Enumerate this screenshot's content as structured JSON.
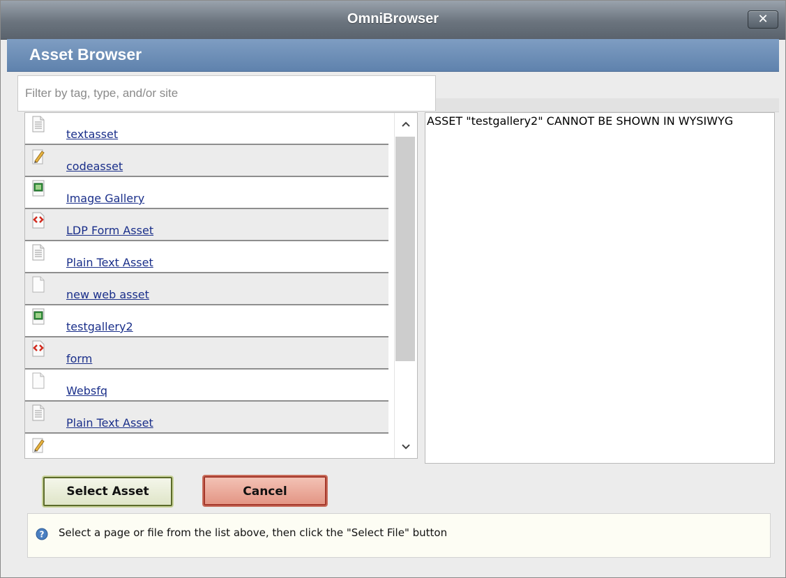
{
  "window": {
    "title": "OmniBrowser",
    "close_label": "✕"
  },
  "header": {
    "title": "Asset Browser"
  },
  "filter": {
    "placeholder": "Filter by tag, type, and/or site",
    "value": ""
  },
  "assets": {
    "items": [
      {
        "label": "textasset",
        "icon": "text-document-icon"
      },
      {
        "label": "codeasset",
        "icon": "pencil-icon"
      },
      {
        "label": "Image Gallery",
        "icon": "image-icon"
      },
      {
        "label": "LDP Form Asset",
        "icon": "form-icon"
      },
      {
        "label": "Plain Text Asset",
        "icon": "text-document-icon"
      },
      {
        "label": "new web asset",
        "icon": "blank-document-icon"
      },
      {
        "label": "testgallery2",
        "icon": "image-icon"
      },
      {
        "label": "form",
        "icon": "form-icon"
      },
      {
        "label": "Websfq",
        "icon": "blank-document-icon"
      },
      {
        "label": "Plain Text Asset",
        "icon": "text-document-icon"
      },
      {
        "label": "",
        "icon": "pencil-icon"
      }
    ],
    "scroll_up": "^",
    "scroll_down": "v"
  },
  "preview": {
    "message": "ASSET \"testgallery2\" CANNOT BE SHOWN IN WYSIWYG"
  },
  "buttons": {
    "select": "Select Asset",
    "cancel": "Cancel"
  },
  "status": {
    "message": "Select a page or file from the list above, then click the \"Select File\" button"
  },
  "colors": {
    "link": "#1a2f8a",
    "header": "#6688b2",
    "titlebar": "#6b747e"
  }
}
